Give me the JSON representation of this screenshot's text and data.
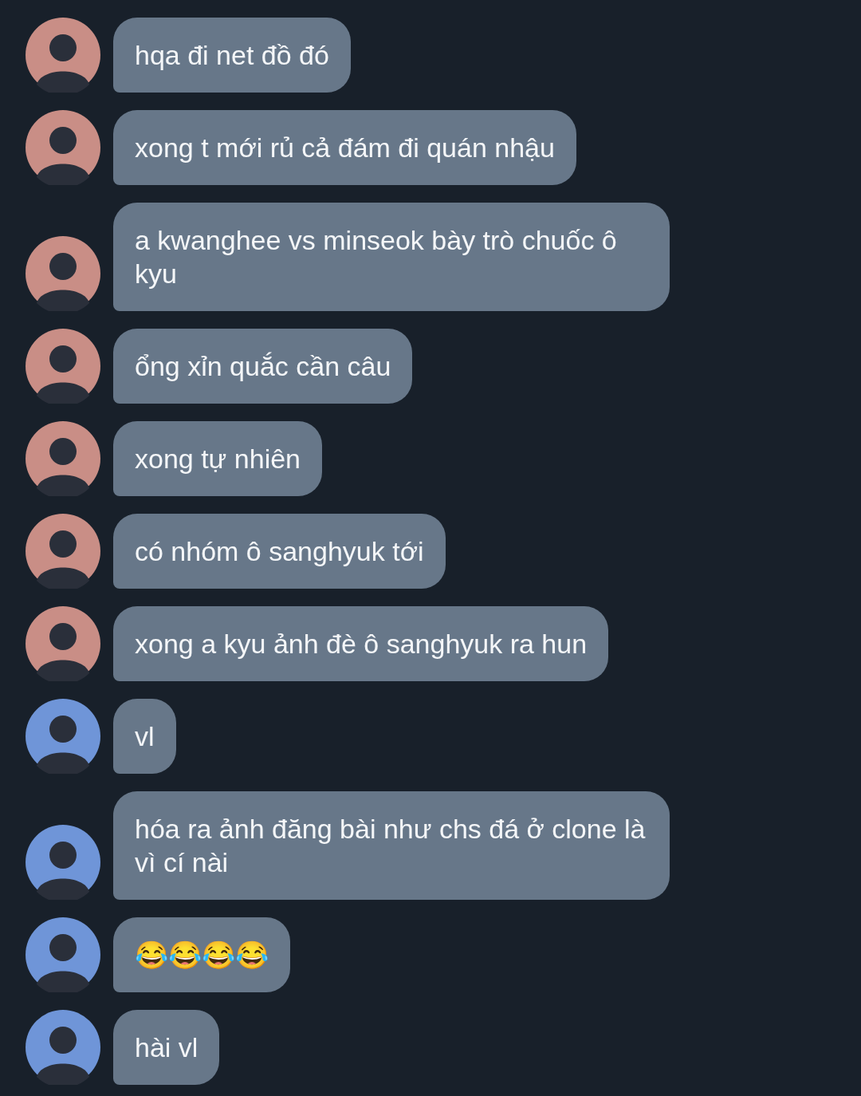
{
  "messages": [
    {
      "text": "hqa đi net đồ đó",
      "color": "#c98e86"
    },
    {
      "text": "xong t mới rủ cả đám đi quán nhậu",
      "color": "#c98e86"
    },
    {
      "text": "a kwanghee vs minseok bày trò chuốc ô kyu",
      "color": "#c98e86"
    },
    {
      "text": "ổng xỉn quắc cần câu",
      "color": "#c98e86"
    },
    {
      "text": "xong tự nhiên",
      "color": "#c98e86"
    },
    {
      "text": "có nhóm ô sanghyuk tới",
      "color": "#c98e86"
    },
    {
      "text": "xong a kyu ảnh đè ô sanghyuk ra hun",
      "color": "#c98e86"
    },
    {
      "text": "vl",
      "color": "#6f95d8"
    },
    {
      "text": "hóa ra ảnh đăng bài như chs đá ở clone là vì cí nài",
      "color": "#6f95d8"
    },
    {
      "text": "😂😂😂😂",
      "color": "#6f95d8"
    },
    {
      "text": "hài vl",
      "color": "#6f95d8"
    }
  ]
}
